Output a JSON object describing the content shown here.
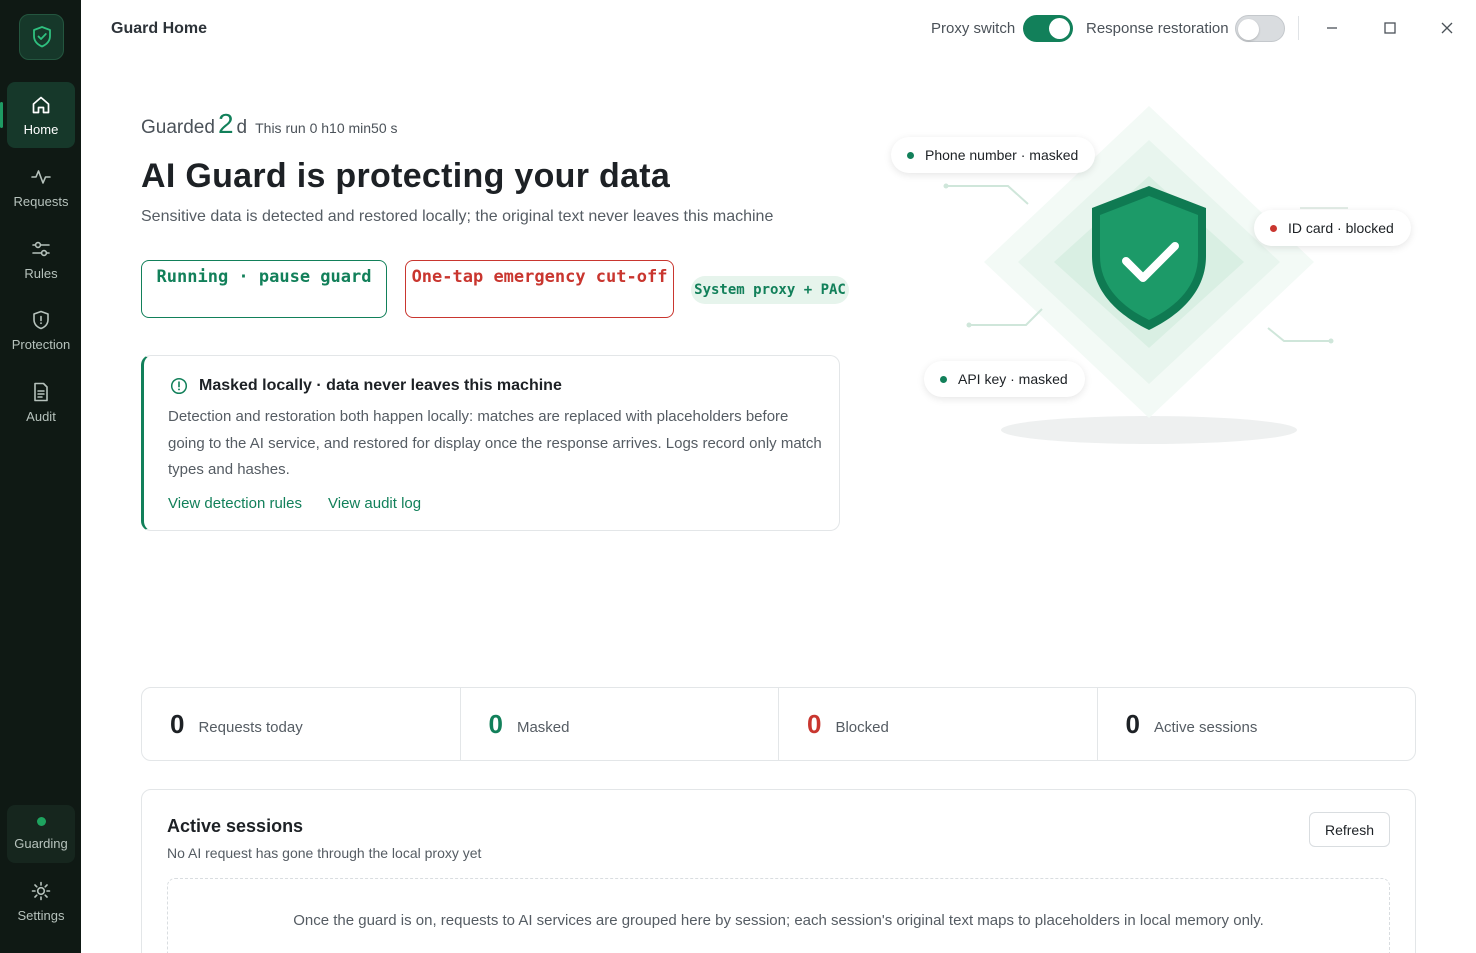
{
  "window": {
    "title": "Guard Home",
    "proxy_switch_label": "Proxy switch",
    "proxy_switch_on": true,
    "response_restoration_label": "Response restoration",
    "response_restoration_on": false
  },
  "sidebar": {
    "items": [
      {
        "label": "Home",
        "icon": "home-icon",
        "active": true
      },
      {
        "label": "Requests",
        "icon": "activity-icon"
      },
      {
        "label": "Rules",
        "icon": "sliders-icon"
      },
      {
        "label": "Protection",
        "icon": "shield-icon"
      },
      {
        "label": "Audit",
        "icon": "document-icon"
      }
    ],
    "status_label": "Guarding",
    "settings_label": "Settings"
  },
  "hero": {
    "guarded_prefix": "Guarded",
    "guarded_days": "2",
    "guarded_unit": "d",
    "this_run": "This run 0 h10 min50 s",
    "headline": "AI Guard is protecting your data",
    "subline": "Sensitive data is detected and restored locally; the original text never leaves this machine",
    "pause_button": "Running · pause guard",
    "cutoff_button": "One-tap emergency cut-off",
    "mode_tag": "System proxy + PAC"
  },
  "info_card": {
    "title": "Masked locally · data never leaves this machine",
    "body": "Detection and restoration both happen locally: matches are replaced with placeholders before going to the AI service, and restored for display once the response arrives. Logs record only match types and hashes.",
    "link_rules": "View detection rules",
    "link_audit": "View audit log"
  },
  "illustration": {
    "bubbles": [
      {
        "label": "Phone number · masked",
        "status_color": "#12805a"
      },
      {
        "label": "ID card · blocked",
        "status_color": "#c9362f"
      },
      {
        "label": "API key · masked",
        "status_color": "#12805a"
      }
    ]
  },
  "stats": [
    {
      "value": "0",
      "label": "Requests today",
      "color": "#1d2125"
    },
    {
      "value": "0",
      "label": "Masked",
      "color": "#12805a"
    },
    {
      "value": "0",
      "label": "Blocked",
      "color": "#c9362f"
    },
    {
      "value": "0",
      "label": "Active sessions",
      "color": "#1d2125"
    }
  ],
  "sessions": {
    "title": "Active sessions",
    "subtitle": "No AI request has gone through the local proxy yet",
    "refresh_label": "Refresh",
    "empty_text": "Once the guard is on, requests to AI services are grouped here by session; each session's original text maps to placeholders in local memory only."
  },
  "colors": {
    "accent": "#12805a",
    "danger": "#c9362f",
    "sidebar": "#0f1914"
  }
}
